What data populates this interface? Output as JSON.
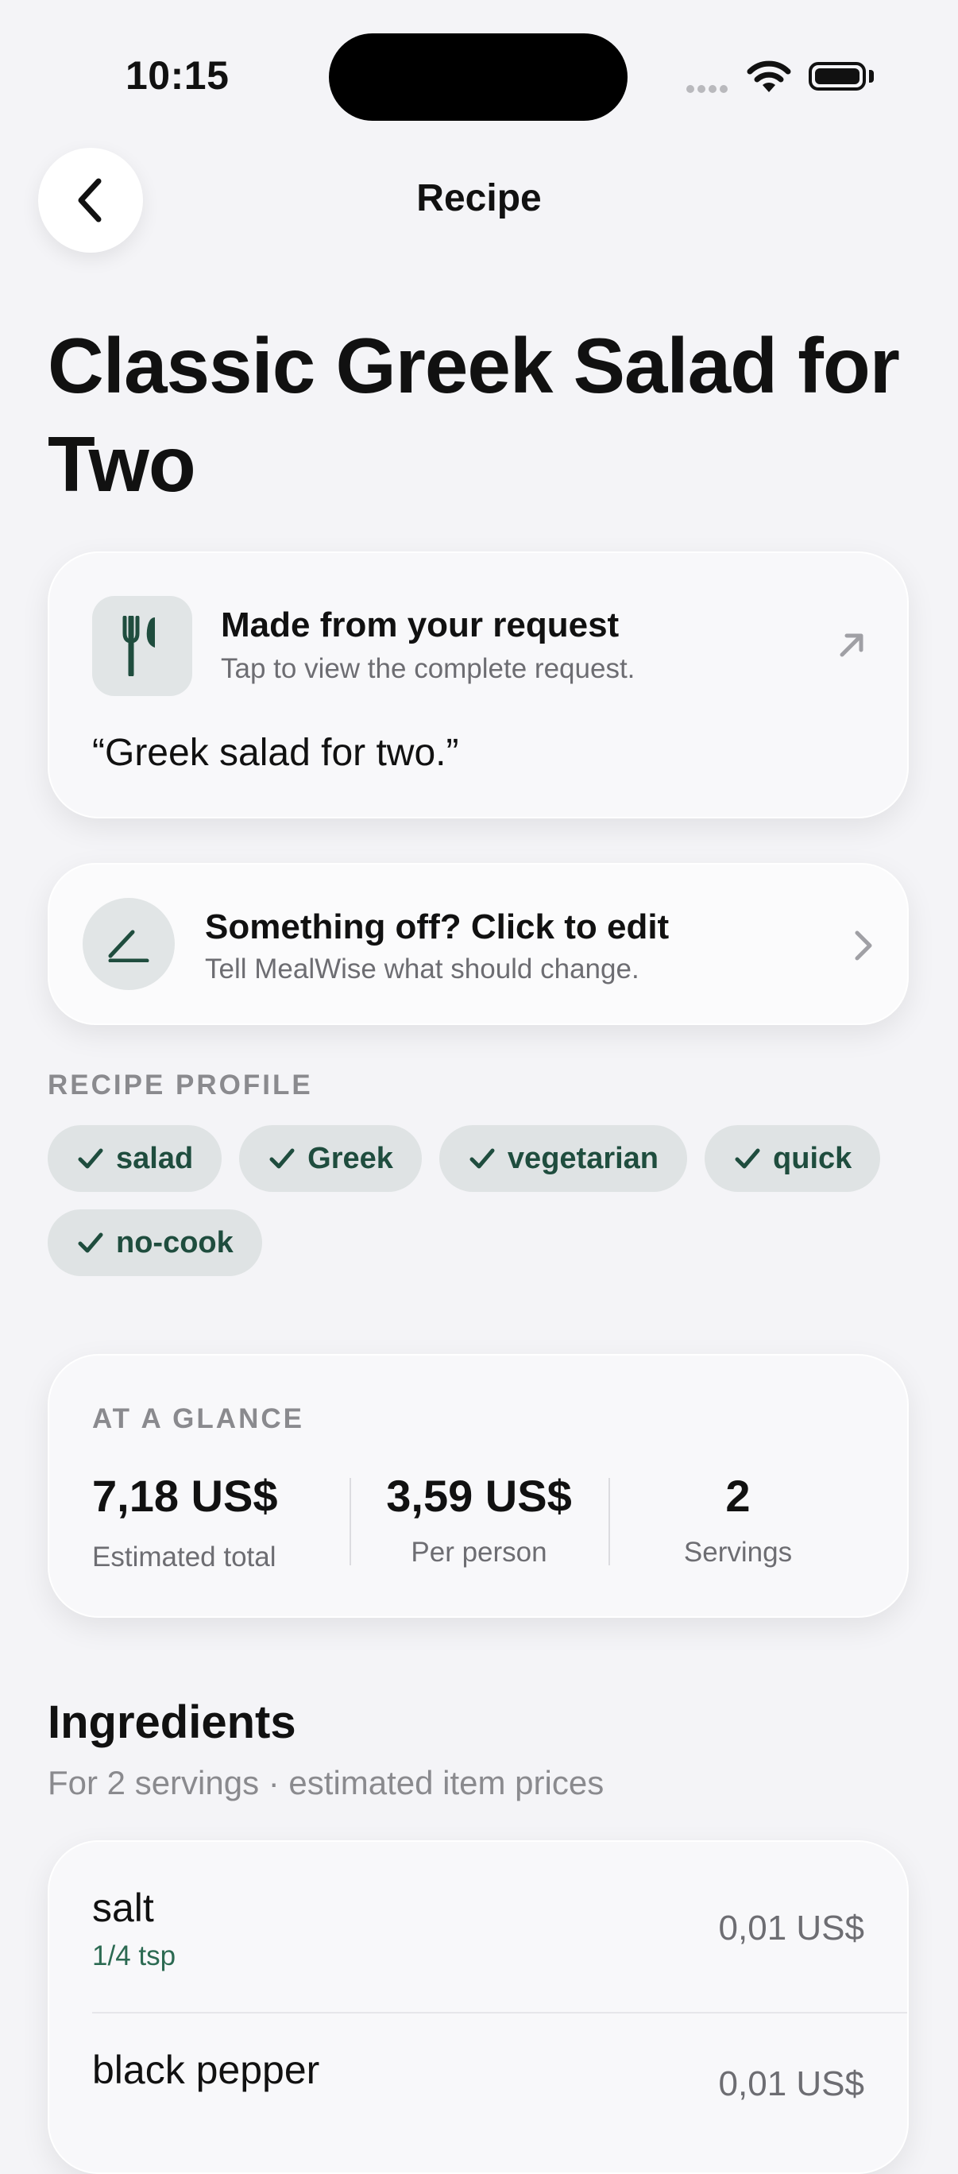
{
  "status_bar": {
    "time": "10:15"
  },
  "nav": {
    "title": "Recipe"
  },
  "page_title": "Classic Greek Salad for Two",
  "request_card": {
    "title": "Made from your request",
    "subtitle": "Tap to view the complete request.",
    "quote": "“Greek salad for two.”"
  },
  "edit_card": {
    "title": "Something off? Click to edit",
    "subtitle": "Tell MealWise what should change."
  },
  "profile": {
    "label": "RECIPE PROFILE",
    "tags": [
      "salad",
      "Greek",
      "vegetarian",
      "quick",
      "no-cook"
    ]
  },
  "glance": {
    "label": "AT A GLANCE",
    "total": {
      "value": "7,18 US$",
      "label": "Estimated total"
    },
    "per_person": {
      "value": "3,59 US$",
      "label": "Per person"
    },
    "servings": {
      "value": "2",
      "label": "Servings"
    }
  },
  "ingredients": {
    "title": "Ingredients",
    "subtitle": "For 2 servings · estimated item prices",
    "items": [
      {
        "name": "salt",
        "qty": "1/4 tsp",
        "price": "0,01 US$"
      },
      {
        "name": "black pepper",
        "qty": "",
        "price": "0,01 US$"
      }
    ]
  },
  "colors": {
    "accent": "#1f4d3e",
    "chip_bg": "#dfe3e4",
    "background": "#f4f4f7"
  }
}
